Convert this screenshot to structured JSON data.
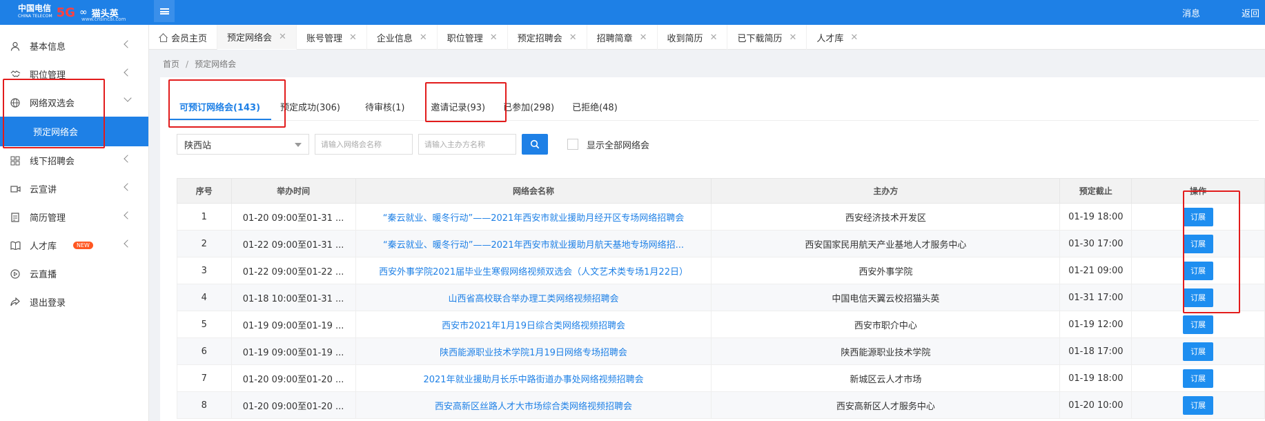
{
  "header": {
    "logo_company": "中国电信",
    "logo_company_en": "CHINA TELECOM",
    "logo_5g": "5G",
    "logo_product": "猫头英",
    "logo_url": "www.cnsincai.com",
    "messages": "消息",
    "back": "返回"
  },
  "sidebar": {
    "items": [
      {
        "label": "基本信息",
        "icon": "user-icon"
      },
      {
        "label": "职位管理",
        "icon": "handshake-icon"
      },
      {
        "label": "网络双选会",
        "icon": "globe-icon"
      },
      {
        "label": "预定网络会",
        "icon": ""
      },
      {
        "label": "线下招聘会",
        "icon": "grid-icon"
      },
      {
        "label": "云宣讲",
        "icon": "video-icon"
      },
      {
        "label": "简历管理",
        "icon": "resume-icon"
      },
      {
        "label": "人才库",
        "icon": "book-icon",
        "badge": "NEW"
      },
      {
        "label": "云直播",
        "icon": "play-icon"
      },
      {
        "label": "退出登录",
        "icon": "share-icon"
      }
    ]
  },
  "tabs": [
    {
      "label": "会员主页"
    },
    {
      "label": "预定网络会"
    },
    {
      "label": "账号管理"
    },
    {
      "label": "企业信息"
    },
    {
      "label": "职位管理"
    },
    {
      "label": "预定招聘会"
    },
    {
      "label": "招聘简章"
    },
    {
      "label": "收到简历"
    },
    {
      "label": "已下载简历"
    },
    {
      "label": "人才库"
    }
  ],
  "breadcrumb": {
    "home": "首页",
    "sep": "/",
    "current": "预定网络会"
  },
  "subtabs": [
    {
      "label": "可预订网络会(143)"
    },
    {
      "label": "预定成功(306)"
    },
    {
      "label": "待审核(1)"
    },
    {
      "label": "邀请记录(93)"
    },
    {
      "label": "已参加(298)"
    },
    {
      "label": "已拒绝(48)"
    }
  ],
  "filters": {
    "station": "陕西站",
    "name_placeholder": "请输入网络会名称",
    "host_placeholder": "请输入主办方名称",
    "show_all_label": "显示全部网络会"
  },
  "table": {
    "headers": [
      "序号",
      "举办时间",
      "网络会名称",
      "主办方",
      "预定截止",
      "操作"
    ],
    "action_label": "订展",
    "rows": [
      {
        "no": "1",
        "time": "01-20 09:00至01-31 ...",
        "name": "“秦云就业、暖冬行动”——2021年西安市就业援助月经开区专场网络招聘会",
        "host": "西安经济技术开发区",
        "deadline": "01-19 18:00"
      },
      {
        "no": "2",
        "time": "01-22 09:00至01-31 ...",
        "name": "“秦云就业、暖冬行动”——2021年西安市就业援助月航天基地专场网络招...",
        "host": "西安国家民用航天产业基地人才服务中心",
        "deadline": "01-30 17:00"
      },
      {
        "no": "3",
        "time": "01-22 09:00至01-22 ...",
        "name": "西安外事学院2021届毕业生寒假网络视频双选会（人文艺术类专场1月22日）",
        "host": "西安外事学院",
        "deadline": "01-21 09:00"
      },
      {
        "no": "4",
        "time": "01-18 10:00至01-31 ...",
        "name": "山西省高校联合举办理工类网络视频招聘会",
        "host": "中国电信天翼云校招猫头英",
        "deadline": "01-31 17:00"
      },
      {
        "no": "5",
        "time": "01-19 09:00至01-19 ...",
        "name": "西安市2021年1月19日综合类网络视频招聘会",
        "host": "西安市职介中心",
        "deadline": "01-19 12:00"
      },
      {
        "no": "6",
        "time": "01-19 09:00至01-19 ...",
        "name": "陕西能源职业技术学院1月19日网络专场招聘会",
        "host": "陕西能源职业技术学院",
        "deadline": "01-18 17:00"
      },
      {
        "no": "7",
        "time": "01-20 09:00至01-20 ...",
        "name": "2021年就业援助月长乐中路街道办事处网络视频招聘会",
        "host": "新城区云人才市场",
        "deadline": "01-19 18:00"
      },
      {
        "no": "8",
        "time": "01-20 09:00至01-20 ...",
        "name": "西安高新区丝路人才大市场综合类网络视频招聘会",
        "host": "西安高新区人才服务中心",
        "deadline": "01-20 10:00"
      }
    ]
  },
  "colors": {
    "primary": "#1e80e6",
    "highlight": "#e21b1b"
  }
}
